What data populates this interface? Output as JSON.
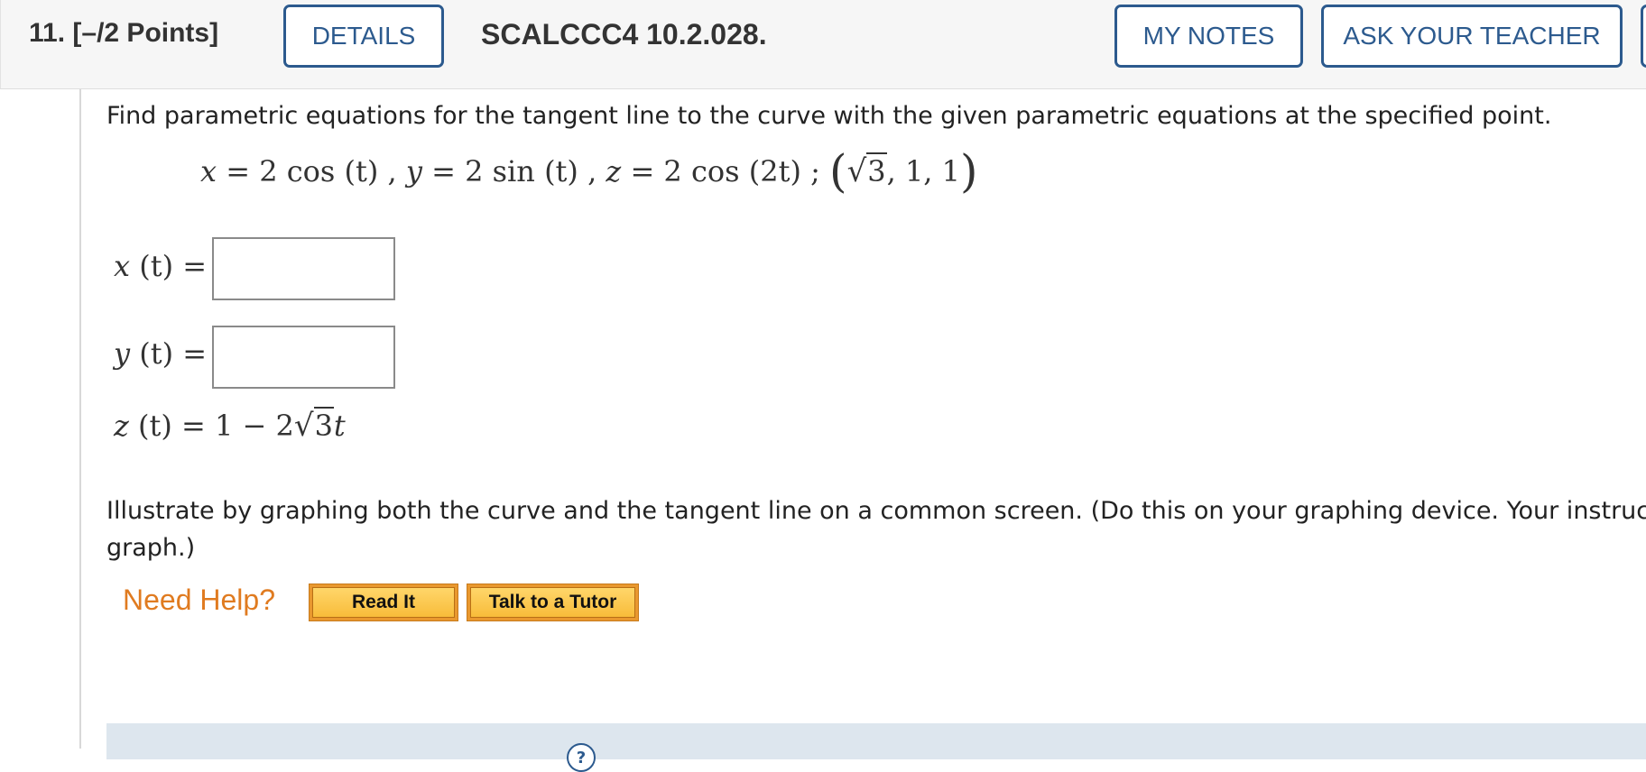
{
  "header": {
    "question_number": "11.",
    "points": "[–/2 Points]",
    "details_label": "DETAILS",
    "question_code": "SCALCCC4 10.2.028.",
    "my_notes_label": "MY NOTES",
    "ask_teacher_label": "ASK YOUR TEACHER"
  },
  "problem": {
    "prompt": "Find parametric equations for the tangent line to the curve with the given parametric equations at the specified point.",
    "given": {
      "x_var": "x",
      "x_expr": " = 2 cos (t) , ",
      "y_var": "y",
      "y_expr": " = 2 sin (t) , ",
      "z_var": "z",
      "z_expr": " = 2 cos (2t) ; ",
      "point_open": "(",
      "sqrt_sign": "√",
      "sqrt_radicand": "3",
      "point_rest": ", 1, 1",
      "point_close": ")"
    }
  },
  "answers": {
    "x_label_var": "x",
    "x_label_rest": " (t) =",
    "x_value": "",
    "y_label_var": "y",
    "y_label_rest": " (t) =",
    "y_value": "",
    "z_label_var": "z",
    "z_label_rest": " (t) = 1 − 2",
    "z_sqrt_sign": "√",
    "z_sqrt_radicand": "3",
    "z_tail": "t"
  },
  "illustrate": {
    "line1": "Illustrate by graphing both the curve and the tangent line on a common screen. (Do this on your graphing device. Your instructor",
    "line2": "graph.)"
  },
  "help": {
    "label": "Need Help?",
    "read_it": "Read It",
    "talk_tutor": "Talk to a Tutor"
  },
  "colors": {
    "accent_blue": "#2c5a8e",
    "help_orange": "#e07b20",
    "button_yellow": "#f8bc3a"
  }
}
